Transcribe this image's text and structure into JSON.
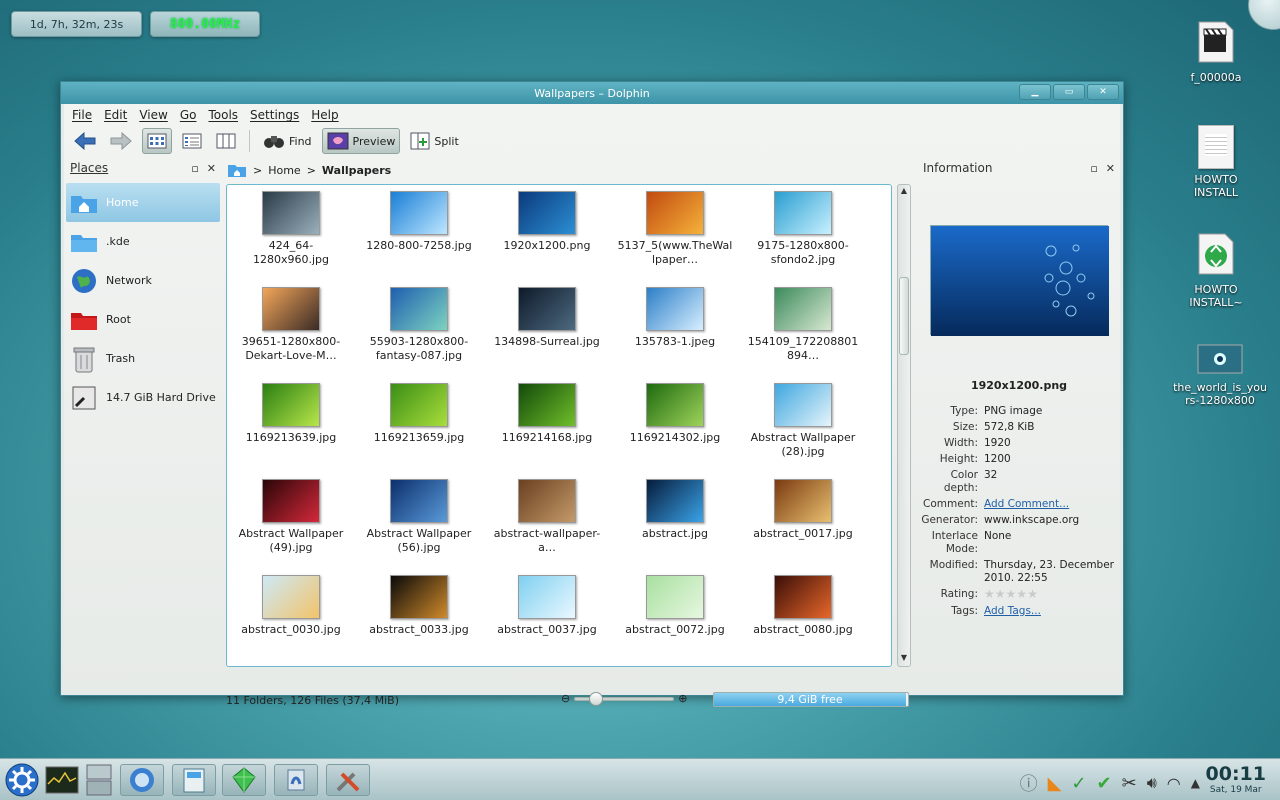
{
  "desktop": {
    "widgets": {
      "uptime": "1d, 7h, 32m, 23s",
      "cpu_freq": "800.00MHz"
    },
    "icons": [
      {
        "label": "f_00000a",
        "icon": "video-clapper-icon"
      },
      {
        "label": "HOWTO INSTALL",
        "icon": "document-icon"
      },
      {
        "label": "HOWTO INSTALL~",
        "icon": "recycle-document-icon"
      },
      {
        "label": "the_world_is_yours-1280x800",
        "icon": "image-icon"
      }
    ]
  },
  "window": {
    "title": "Wallpapers – Dolphin",
    "controls": {
      "minimize": "▁",
      "maximize": "▭",
      "close": "✕"
    },
    "menu": [
      "File",
      "Edit",
      "View",
      "Go",
      "Tools",
      "Settings",
      "Help"
    ],
    "toolbar": {
      "find": "Find",
      "preview": "Preview",
      "split": "Split"
    },
    "places": {
      "title": "Places",
      "items": [
        {
          "label": "Home",
          "icon": "home-folder-icon",
          "active": true
        },
        {
          "label": ".kde",
          "icon": "folder-icon"
        },
        {
          "label": "Network",
          "icon": "network-globe-icon"
        },
        {
          "label": "Root",
          "icon": "root-folder-icon"
        },
        {
          "label": "Trash",
          "icon": "trash-icon"
        },
        {
          "label": "14.7 GiB Hard Drive",
          "icon": "hard-drive-icon"
        }
      ]
    },
    "breadcrumb": [
      "Home",
      "Wallpapers"
    ],
    "files": [
      {
        "name": "424_64-1280x960.jpg",
        "colors": [
          "#2b3b48",
          "#9ab0bc"
        ]
      },
      {
        "name": "1280-800-7258.jpg",
        "colors": [
          "#1a7fd6",
          "#bde6ff"
        ]
      },
      {
        "name": "1920x1200.png",
        "colors": [
          "#0b3a7c",
          "#2c8fd4"
        ]
      },
      {
        "name": "5137_5(www.TheWallpaper…",
        "colors": [
          "#c24b10",
          "#f5b23a"
        ]
      },
      {
        "name": "9175-1280x800-sfondo2.jpg",
        "colors": [
          "#2a9ed0",
          "#c8f0ff"
        ]
      },
      {
        "name": "39651-1280x800-Dekart-Love-M…",
        "colors": [
          "#f3a65a",
          "#3a2a26"
        ]
      },
      {
        "name": "55903-1280x800-fantasy-087.jpg",
        "colors": [
          "#1f5fb0",
          "#7dd3c0"
        ]
      },
      {
        "name": "134898-Surreal.jpg",
        "colors": [
          "#0e1a2a",
          "#4d6a80"
        ]
      },
      {
        "name": "135783-1.jpeg",
        "colors": [
          "#2c7fc8",
          "#d8efff"
        ]
      },
      {
        "name": "154109_172208801894…",
        "colors": [
          "#3c8a5c",
          "#d8e8d2"
        ]
      },
      {
        "name": "1169213639.jpg",
        "colors": [
          "#2a7f12",
          "#b8e64a"
        ]
      },
      {
        "name": "1169213659.jpg",
        "colors": [
          "#3b8e15",
          "#a9de3c"
        ]
      },
      {
        "name": "1169214168.jpg",
        "colors": [
          "#134a0a",
          "#6fbf2a"
        ]
      },
      {
        "name": "1169214302.jpg",
        "colors": [
          "#1f6a10",
          "#9ed35a"
        ]
      },
      {
        "name": "Abstract Wallpaper (28).jpg",
        "colors": [
          "#3fa7e0",
          "#e6f4fa"
        ]
      },
      {
        "name": "Abstract Wallpaper (49).jpg",
        "colors": [
          "#2a0608",
          "#d4283a"
        ]
      },
      {
        "name": "Abstract Wallpaper (56).jpg",
        "colors": [
          "#0c2f6d",
          "#5a9ad8"
        ]
      },
      {
        "name": "abstract-wallpaper-a…",
        "colors": [
          "#6a4020",
          "#c49a6a"
        ]
      },
      {
        "name": "abstract.jpg",
        "colors": [
          "#061c3c",
          "#3aa3e8"
        ]
      },
      {
        "name": "abstract_0017.jpg",
        "colors": [
          "#7a3a10",
          "#e8c070"
        ]
      },
      {
        "name": "abstract_0030.jpg",
        "colors": [
          "#cde9f6",
          "#f2c36a"
        ]
      },
      {
        "name": "abstract_0033.jpg",
        "colors": [
          "#0a0a0a",
          "#d08a2a"
        ]
      },
      {
        "name": "abstract_0037.jpg",
        "colors": [
          "#7fd0f0",
          "#eaf8ff"
        ]
      },
      {
        "name": "abstract_0072.jpg",
        "colors": [
          "#a9e0a0",
          "#e6f7e0"
        ]
      },
      {
        "name": "abstract_0080.jpg",
        "colors": [
          "#3a0e08",
          "#e9672a"
        ]
      }
    ],
    "information": {
      "title": "Information",
      "file_name": "1920x1200.png",
      "rows": [
        {
          "key": "Type:",
          "value": "PNG image"
        },
        {
          "key": "Size:",
          "value": "572,8 KiB"
        },
        {
          "key": "Width:",
          "value": "1920"
        },
        {
          "key": "Height:",
          "value": "1200"
        },
        {
          "key": "Color depth:",
          "value": "32"
        },
        {
          "key": "Comment:",
          "value": "Add Comment...",
          "link": true
        },
        {
          "key": "Generator:",
          "value": "www.inkscape.org"
        },
        {
          "key": "Interlace Mode:",
          "value": "None"
        },
        {
          "key": "Modified:",
          "value": "Thursday, 23. December 2010. 22:55"
        },
        {
          "key": "Rating:",
          "value": "",
          "stars": 0
        },
        {
          "key": "Tags:",
          "value": "Add Tags...",
          "link": true
        }
      ]
    },
    "status": {
      "summary": "11 Folders, 126 Files (37,4 MiB)",
      "free_space": "9,4 GiB free",
      "used_fraction": 0.99
    }
  },
  "taskbar": {
    "clock_time": "00:11",
    "clock_date": "Sat, 19 Mar",
    "colors": {
      "accent": "#4aa9de",
      "title_bar": "#3d93a7"
    }
  }
}
